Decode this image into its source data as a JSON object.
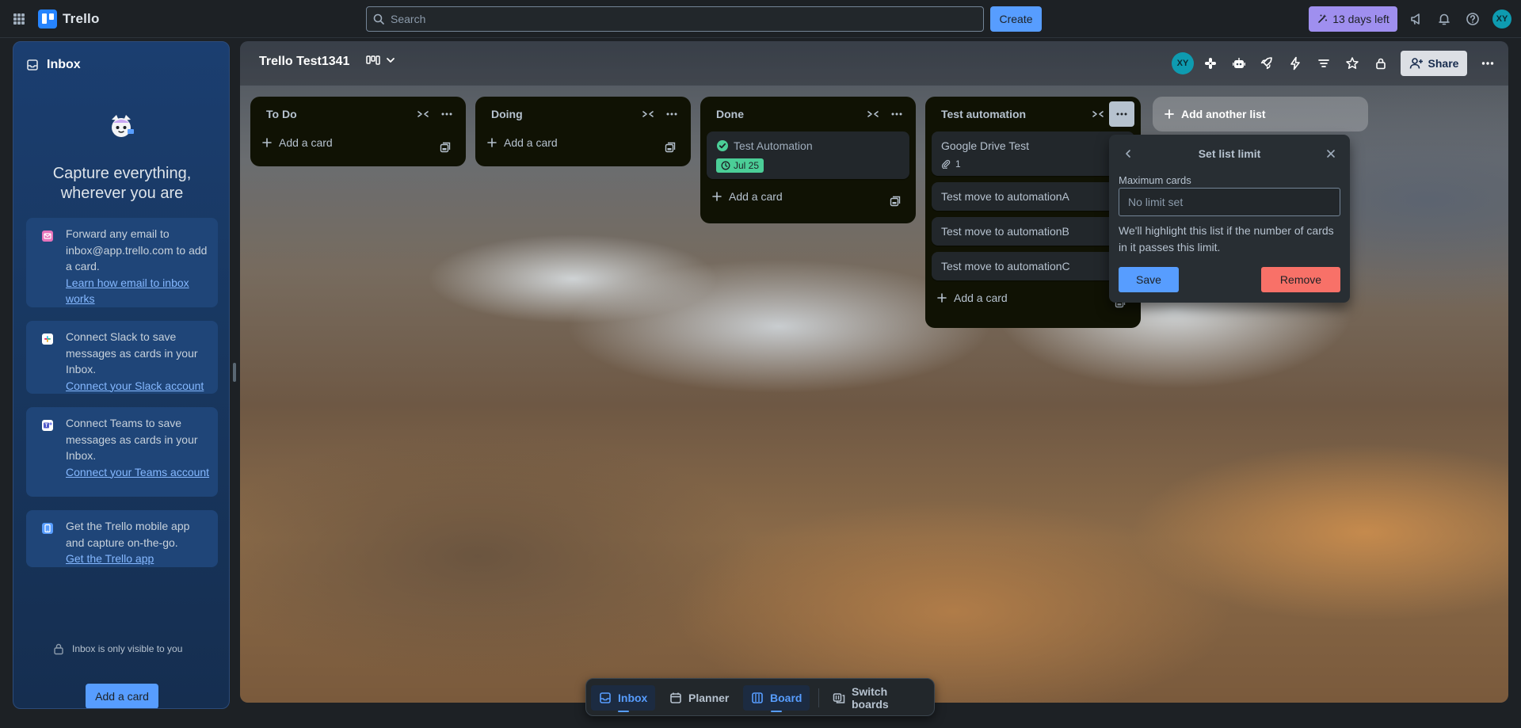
{
  "app": {
    "name": "Trello"
  },
  "topbar": {
    "search_placeholder": "Search",
    "create_label": "Create",
    "trial_label": "13 days left",
    "avatar_initials": "XY"
  },
  "inbox": {
    "title": "Inbox",
    "headline": "Capture everything, wherever you are",
    "cards": [
      {
        "text": "Forward any email to inbox@app.trello.com to add a card.",
        "link": "Learn how email to inbox works",
        "icon": "email-icon"
      },
      {
        "text": "Connect Slack to save messages as cards in your Inbox.",
        "link": "Connect your Slack account",
        "icon": "slack-icon"
      },
      {
        "text": "Connect Teams to save messages as cards in your Inbox.",
        "link": "Connect your Teams account",
        "icon": "teams-icon"
      },
      {
        "text": "Get the Trello mobile app and capture on-the-go.",
        "link": "Get the Trello app",
        "icon": "mobile-icon"
      }
    ],
    "privacy_note": "Inbox is only visible to you",
    "add_card_label": "Add a card"
  },
  "board": {
    "title": "Trello Test1341",
    "member_initials": "XY",
    "share_label": "Share",
    "add_list_label": "Add another list",
    "lists": [
      {
        "title": "To Do",
        "add_label": "Add a card",
        "cards": []
      },
      {
        "title": "Doing",
        "add_label": "Add a card",
        "cards": []
      },
      {
        "title": "Done",
        "add_label": "Add a card",
        "cards": [
          {
            "title": "Test Automation",
            "date": "Jul 25",
            "completed": true
          }
        ]
      },
      {
        "title": "Test automation",
        "add_label": "Add a card",
        "cards": [
          {
            "title": "Google Drive Test",
            "attachments": "1"
          },
          {
            "title": "Test move to automationA"
          },
          {
            "title": "Test move to automationB"
          },
          {
            "title": "Test move to automationC"
          }
        ]
      }
    ]
  },
  "popover": {
    "title": "Set list limit",
    "label": "Maximum cards",
    "placeholder": "No limit set",
    "help": "We'll highlight this list if the number of cards in it passes this limit.",
    "save_label": "Save",
    "remove_label": "Remove"
  },
  "switcher": {
    "items": [
      {
        "label": "Inbox",
        "active": true
      },
      {
        "label": "Planner",
        "active": false
      },
      {
        "label": "Board",
        "active": true
      },
      {
        "label": "Switch boards",
        "active": false
      }
    ]
  },
  "colors": {
    "accent": "#579dff",
    "trial": "#9f8fef",
    "date_badge": "#4bce97",
    "remove": "#f87168",
    "list_bg": "#101204"
  }
}
